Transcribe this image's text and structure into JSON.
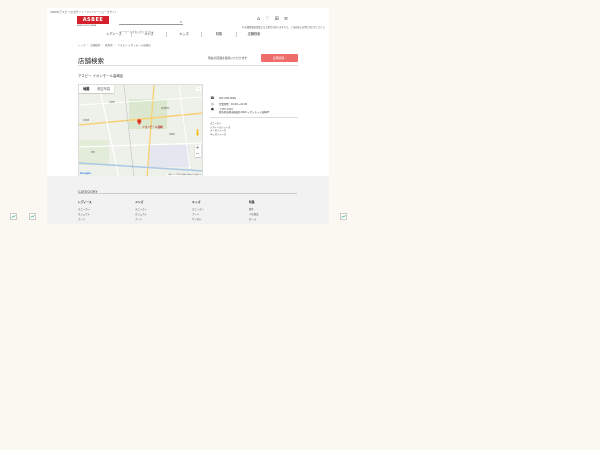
{
  "header": {
    "topline": "ASBEE(アスビー)公式サイトーファミリーシューズサイト",
    "logo": "ASBEE",
    "logo_sub": "ASBEE   SHOES MANIA",
    "search_placeholder": "キーワードをお入力ください",
    "notices": "※ 店舗情報は変更になる場合がありますので、ご来店前にお問い合わせください",
    "icons": [
      "store-icon",
      "favorite-icon",
      "cart-icon",
      "menu-icon"
    ]
  },
  "nav": [
    "レディース",
    "メンズ",
    "キッズ",
    "特集",
    "店舗検索"
  ],
  "breadcrumb": [
    "トップ",
    "店舗検索",
    "群馬県",
    "アスビー イオンモール高崎店"
  ],
  "page": {
    "title": "店舗検索",
    "near_text": "現在の店舗を検索いただけます",
    "near_button": "近隣店舗 ›",
    "shop_name": "アスビー イオンモール高崎店"
  },
  "map": {
    "tab_map": "地図",
    "tab_satellite": "航空写真",
    "pin_label": "イオンモール高崎",
    "google": "Google",
    "attribution": "地図データ ©2022 利用規約 地図の誤りを報告する",
    "labels": [
      "高崎線",
      "倉賀野駅",
      "岩鼻町",
      "井野町",
      "新町"
    ]
  },
  "info": {
    "tel": "027-000-0000",
    "hours": "営業時間：10:00〜21:00",
    "address_zip": "〒370-1201",
    "address": "群馬県高崎市棟高町1400 イオンモール高崎2F",
    "categories": [
      "スニーカー",
      "レディースシューズ",
      "メンズシューズ",
      "キッズシューズ"
    ]
  },
  "footer": {
    "heading": "CATEGORY",
    "columns": [
      {
        "title": "レディース",
        "items": [
          "スニーカー",
          "カジュアル",
          "ブーツ"
        ]
      },
      {
        "title": "メンズ",
        "items": [
          "スニーカー",
          "カジュアル",
          "ブーツ"
        ]
      },
      {
        "title": "キッズ",
        "items": [
          "スニーカー",
          "ブーツ",
          "サンダル"
        ]
      },
      {
        "title": "特集",
        "items": [
          "新作",
          "人気商品",
          "セール"
        ]
      }
    ]
  },
  "colors": {
    "brand_red": "#d4202b",
    "button_coral": "#ef6c6c",
    "background": "#faf8f1"
  }
}
